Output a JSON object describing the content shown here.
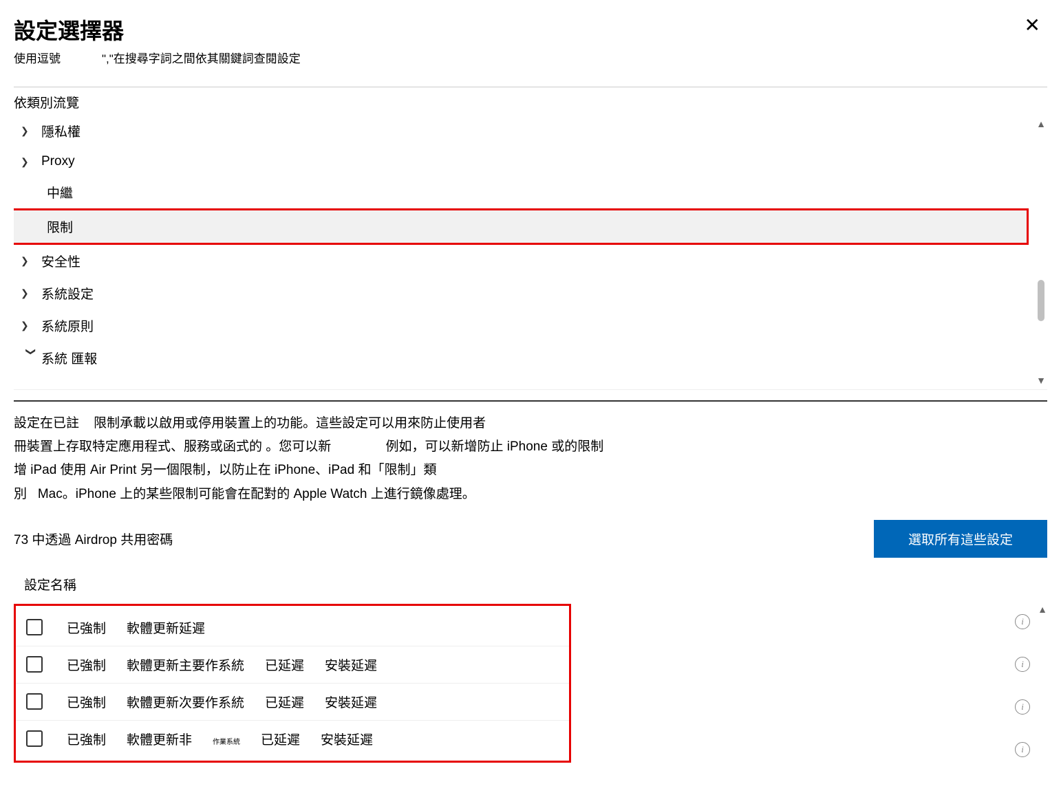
{
  "header": {
    "title": "設定選擇器",
    "hint_prefix": "使用逗號",
    "hint_quote": "\",\"",
    "hint_suffix": "在搜尋字詞之間依其關鍵詞查閱設定"
  },
  "browse_label": "依類別流覽",
  "tree": [
    {
      "label": "隱私權",
      "chev": "right",
      "sub": false,
      "selected": false
    },
    {
      "label": "Proxy",
      "chev": "right",
      "sub": false,
      "selected": false
    },
    {
      "label": "中繼",
      "chev": "none",
      "sub": true,
      "selected": false
    },
    {
      "label": "限制",
      "chev": "none",
      "sub": true,
      "selected": true
    },
    {
      "label": "安全性",
      "chev": "right",
      "sub": false,
      "selected": false
    },
    {
      "label": "系統設定",
      "chev": "right",
      "sub": false,
      "selected": false
    },
    {
      "label": "系統原則",
      "chev": "right",
      "sub": false,
      "selected": false
    },
    {
      "label": "系統 匯報",
      "chev": "down",
      "sub": false,
      "selected": false
    }
  ],
  "description": {
    "line1a": "設定在已註",
    "line1b": "限制承載以啟用或停用裝置上的功能。這些設定可以用來防止使用者",
    "line2a": "冊裝置上存取特定應用程式、服務或函式的 。您可以新",
    "line2b": "例如，可以新增防止 iPhone 或的限制",
    "line3": "增 iPad 使用 Air Print 另一個限制，以防止在 iPhone、iPad 和「限制」類",
    "line4a": "別",
    "line4b": "Mac。iPhone 上的某些限制可能會在配對的 Apple Watch 上進行鏡像處理。"
  },
  "count_text": "73 中透過 Airdrop 共用密碼",
  "select_all_label": "選取所有這些設定",
  "settings_name_label": "設定名稱",
  "settings": [
    {
      "parts": [
        "已強制",
        "軟體更新延遲"
      ]
    },
    {
      "parts": [
        "已強制",
        "軟體更新主要作系統",
        "已延遲",
        "安裝延遲"
      ]
    },
    {
      "parts": [
        "已強制",
        "軟體更新次要作系統",
        "已延遲",
        "安裝延遲"
      ]
    },
    {
      "parts": [
        "已強制",
        "軟體更新非",
        "作業系統",
        "已延遲",
        "安裝延遲"
      ],
      "small_index": 2
    }
  ]
}
